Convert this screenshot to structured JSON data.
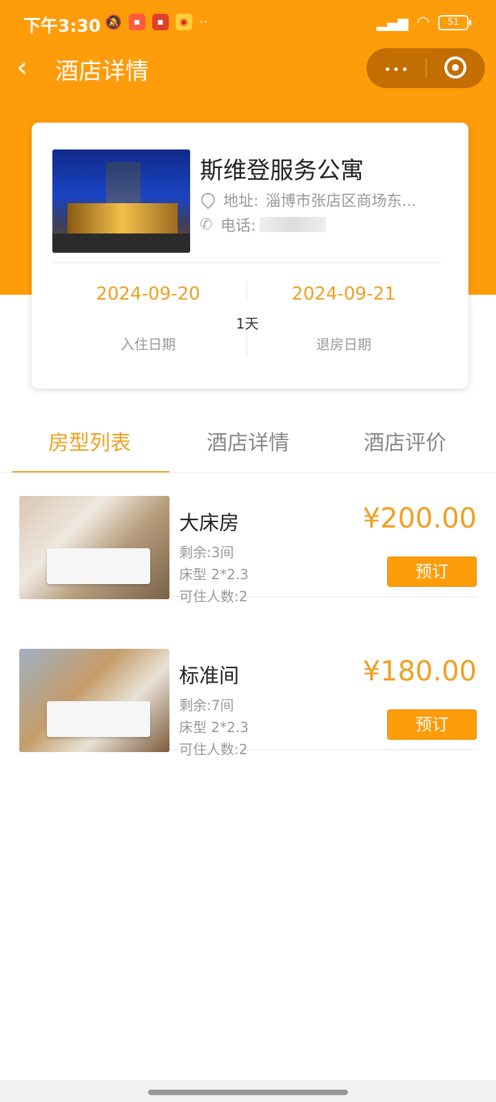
{
  "status_bar": {
    "time": "下午3:30",
    "battery": "51",
    "icons": [
      "mute-icon",
      "app-red-icon",
      "app-orange-icon",
      "weibo-icon",
      "more-dots-icon",
      "signal-icon",
      "wifi-icon",
      "battery-icon"
    ]
  },
  "nav": {
    "title": "酒店详情",
    "back_glyph": "‹",
    "more_glyph": "•••"
  },
  "hotel": {
    "name": "斯维登服务公寓",
    "address_label": "地址:",
    "address": "淄博市张店区商场东...",
    "phone_label": "电话:",
    "checkin_date": "2024-09-20",
    "checkout_date": "2024-09-21",
    "nights": "1天",
    "checkin_label": "入住日期",
    "checkout_label": "退房日期"
  },
  "tabs": [
    {
      "label": "房型列表",
      "active": true
    },
    {
      "label": "酒店详情",
      "active": false
    },
    {
      "label": "酒店评价",
      "active": false
    }
  ],
  "rooms": [
    {
      "name": "大床房",
      "remaining": "剩余:3间",
      "bed": "床型 2*2.3",
      "occupancy": "可住人数:2",
      "price": "¥200.00",
      "book_label": "预订"
    },
    {
      "name": "标准间",
      "remaining": "剩余:7间",
      "bed": "床型 2*2.3",
      "occupancy": "可住人数:2",
      "price": "¥180.00",
      "book_label": "预订"
    }
  ],
  "colors": {
    "accent": "#ff9c0a",
    "price": "#f0a020"
  }
}
